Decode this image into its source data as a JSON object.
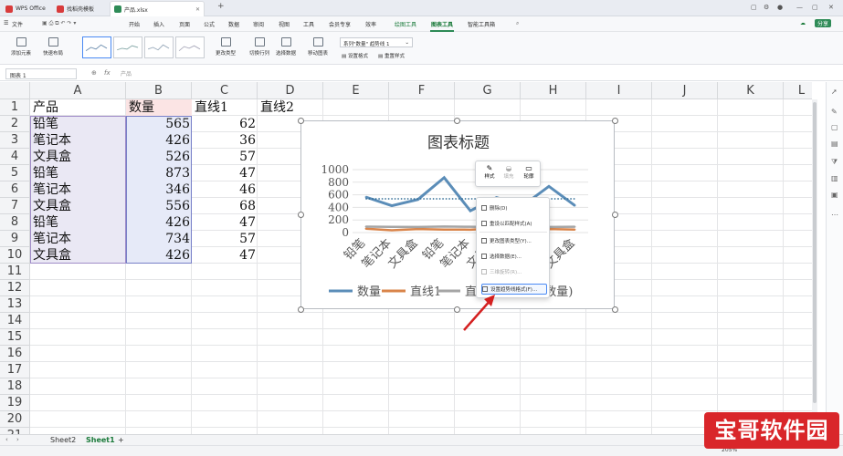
{
  "titlebar": {
    "tabs": [
      {
        "label": "WPS Office",
        "color": "#d83b3b"
      },
      {
        "label": "找稻壳模板",
        "color": "#d83b3b"
      },
      {
        "label": "产品.xlsx",
        "color": "#2e8b57"
      }
    ],
    "new_tab": "+"
  },
  "menubar": {
    "file": "文件",
    "items": [
      "开始",
      "插入",
      "页面",
      "公式",
      "数据",
      "审阅",
      "视图",
      "工具",
      "会员专享",
      "效率",
      "绘图工具",
      "图表工具",
      "智能工具箱"
    ],
    "selected": "图表工具",
    "share": "分享"
  },
  "ribbon": {
    "add_element": "添加元素",
    "quick_layout": "快速布局",
    "change_type": "更改类型",
    "switch_rowcol": "切换行列",
    "select_data": "选择数据",
    "move_chart": "移动图表",
    "series_selector": "系列\"数量\" 趋势线 1",
    "set_format": "设置格式",
    "reset_style": "重置样式"
  },
  "formula_bar": {
    "name_box": "图表 1",
    "fx_hint": "产品"
  },
  "columns": [
    "A",
    "B",
    "C",
    "D",
    "E",
    "F",
    "G",
    "H",
    "I",
    "J",
    "K",
    "L"
  ],
  "rows": [
    "1",
    "2",
    "3",
    "4",
    "5",
    "6",
    "7",
    "8",
    "9",
    "10",
    "11",
    "12",
    "13",
    "14",
    "15",
    "16",
    "17",
    "18",
    "19",
    "20",
    "21"
  ],
  "table": {
    "headers": [
      "产品",
      "数量",
      "直线1",
      "直线2"
    ],
    "rows": [
      [
        "铅笔",
        "565",
        "62"
      ],
      [
        "笔记本",
        "426",
        "36"
      ],
      [
        "文具盒",
        "526",
        "57"
      ],
      [
        "铅笔",
        "873",
        "47"
      ],
      [
        "笔记本",
        "346",
        "46"
      ],
      [
        "文具盒",
        "556",
        "68"
      ],
      [
        "铅笔",
        "426",
        "47"
      ],
      [
        "笔记本",
        "734",
        "57"
      ],
      [
        "文具盒",
        "426",
        "47"
      ]
    ]
  },
  "chart_data": {
    "type": "line",
    "title": "图表标题",
    "categories": [
      "铅笔",
      "笔记本",
      "文具盒",
      "铅笔",
      "笔记本",
      "文具盒",
      "铅笔",
      "笔记本",
      "文具盒"
    ],
    "ylim": [
      0,
      1000
    ],
    "yticks": [
      "1000",
      "800",
      "600",
      "400",
      "200",
      "0"
    ],
    "grid": true,
    "legend_position": "bottom",
    "series": [
      {
        "name": "数量",
        "values": [
          565,
          426,
          526,
          873,
          346,
          556,
          426,
          734,
          426
        ],
        "color": "#5b8db8"
      },
      {
        "name": "直线1",
        "values": [
          62,
          36,
          57,
          47,
          46,
          68,
          47,
          57,
          47
        ],
        "color": "#d9844a"
      },
      {
        "name": "直线2",
        "values": [
          95,
          90,
          88,
          96,
          92,
          85,
          90,
          88,
          92
        ],
        "color": "#a5a5a5"
      }
    ],
    "trendline": {
      "value": 537,
      "color": "#2f6a93"
    },
    "legend": [
      "数量",
      "直线1",
      "直",
      "性 (数量)"
    ]
  },
  "mini_toolbar": {
    "style": "样式",
    "fill": "填充",
    "outline": "轮廓"
  },
  "context_menu": {
    "items": [
      {
        "label": "删除(D)",
        "disabled": false
      },
      {
        "label": "重设以匹配样式(A)",
        "disabled": false
      },
      {
        "label": "更改图表类型(Y)...",
        "disabled": false
      },
      {
        "label": "选择数据(E)...",
        "disabled": false
      },
      {
        "label": "三维旋转(R)...",
        "disabled": true
      },
      {
        "label": "设置趋势线格式(F)...",
        "disabled": false
      }
    ]
  },
  "sheets": [
    "Sheet2",
    "Sheet1"
  ],
  "active_sheet": "Sheet1",
  "status": {
    "zoom": "205%"
  },
  "watermark": "宝哥软件园"
}
